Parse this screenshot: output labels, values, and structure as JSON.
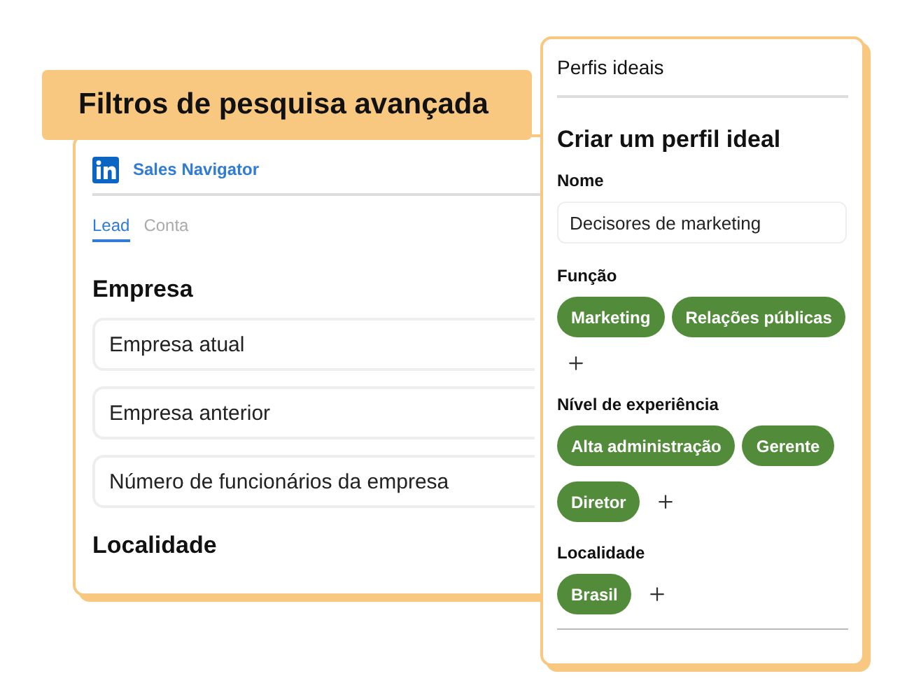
{
  "banner": {
    "title": "Filtros de pesquisa avançada"
  },
  "search_panel": {
    "brand": "Sales Navigator",
    "tabs": [
      {
        "label": "Lead",
        "selected": true
      },
      {
        "label": "Conta",
        "selected": false
      }
    ],
    "sections": [
      {
        "title": "Empresa",
        "filters": [
          "Empresa atual",
          "Empresa anterior",
          "Número de funcionários da empresa"
        ]
      },
      {
        "title": "Localidade"
      }
    ]
  },
  "profile_panel": {
    "title": "Perfis ideais",
    "heading": "Criar um perfil ideal",
    "name_label": "Nome",
    "name_value": "Decisores de marketing",
    "groups": [
      {
        "label": "Função",
        "tags": [
          "Marketing",
          "Relações públicas"
        ]
      },
      {
        "label": "Nível de experiência",
        "tags": [
          "Alta administração",
          "Gerente",
          "Diretor"
        ]
      },
      {
        "label": "Localidade",
        "tags": [
          "Brasil"
        ]
      }
    ]
  }
}
